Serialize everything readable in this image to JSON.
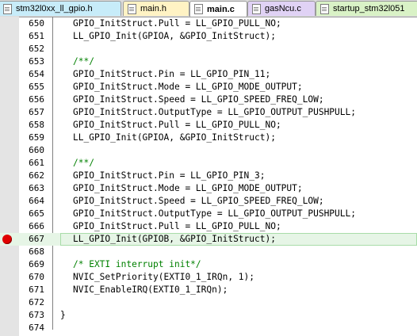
{
  "tabs": [
    {
      "label": "stm32l0xx_ll_gpio.h",
      "color": "#c7ecf9"
    },
    {
      "label": "main.h",
      "color": "#fff3c4"
    },
    {
      "label": "main.c",
      "color": "#ffffff",
      "active": true
    },
    {
      "label": "gasNcu.c",
      "color": "#e0d2f5"
    },
    {
      "label": "startup_stm32l051",
      "color": "#d9f2c6"
    }
  ],
  "editor": {
    "breakpoint_line": "667",
    "current_line": "667",
    "lines": [
      {
        "num": "650",
        "text": "GPIO_InitStruct.Pull = LL_GPIO_PULL_NO;",
        "kind": "code"
      },
      {
        "num": "651",
        "text": "LL_GPIO_Init(GPIOA, &GPIO_InitStruct);",
        "kind": "code"
      },
      {
        "num": "652",
        "text": "",
        "kind": "code"
      },
      {
        "num": "653",
        "text": "/**/",
        "kind": "comment"
      },
      {
        "num": "654",
        "text": "GPIO_InitStruct.Pin = LL_GPIO_PIN_11;",
        "kind": "code"
      },
      {
        "num": "655",
        "text": "GPIO_InitStruct.Mode = LL_GPIO_MODE_OUTPUT;",
        "kind": "code"
      },
      {
        "num": "656",
        "text": "GPIO_InitStruct.Speed = LL_GPIO_SPEED_FREQ_LOW;",
        "kind": "code"
      },
      {
        "num": "657",
        "text": "GPIO_InitStruct.OutputType = LL_GPIO_OUTPUT_PUSHPULL;",
        "kind": "code"
      },
      {
        "num": "658",
        "text": "GPIO_InitStruct.Pull = LL_GPIO_PULL_NO;",
        "kind": "code"
      },
      {
        "num": "659",
        "text": "LL_GPIO_Init(GPIOA, &GPIO_InitStruct);",
        "kind": "code"
      },
      {
        "num": "660",
        "text": "",
        "kind": "code"
      },
      {
        "num": "661",
        "text": "/**/",
        "kind": "comment"
      },
      {
        "num": "662",
        "text": "GPIO_InitStruct.Pin = LL_GPIO_PIN_3;",
        "kind": "code"
      },
      {
        "num": "663",
        "text": "GPIO_InitStruct.Mode = LL_GPIO_MODE_OUTPUT;",
        "kind": "code"
      },
      {
        "num": "664",
        "text": "GPIO_InitStruct.Speed = LL_GPIO_SPEED_FREQ_LOW;",
        "kind": "code"
      },
      {
        "num": "665",
        "text": "GPIO_InitStruct.OutputType = LL_GPIO_OUTPUT_PUSHPULL;",
        "kind": "code"
      },
      {
        "num": "666",
        "text": "GPIO_InitStruct.Pull = LL_GPIO_PULL_NO;",
        "kind": "code"
      },
      {
        "num": "667",
        "text": "LL_GPIO_Init(GPIOB, &GPIO_InitStruct);",
        "kind": "code"
      },
      {
        "num": "668",
        "text": "",
        "kind": "code"
      },
      {
        "num": "669",
        "text": "/* EXTI interrupt init*/",
        "kind": "comment"
      },
      {
        "num": "670",
        "text": "NVIC_SetPriority(EXTI0_1_IRQn, 1);",
        "kind": "code"
      },
      {
        "num": "671",
        "text": "NVIC_EnableIRQ(EXTI0_1_IRQn);",
        "kind": "code"
      },
      {
        "num": "672",
        "text": "",
        "kind": "code"
      },
      {
        "num": "673",
        "text": "}",
        "kind": "brace"
      },
      {
        "num": "674",
        "text": "",
        "kind": "code"
      }
    ]
  }
}
